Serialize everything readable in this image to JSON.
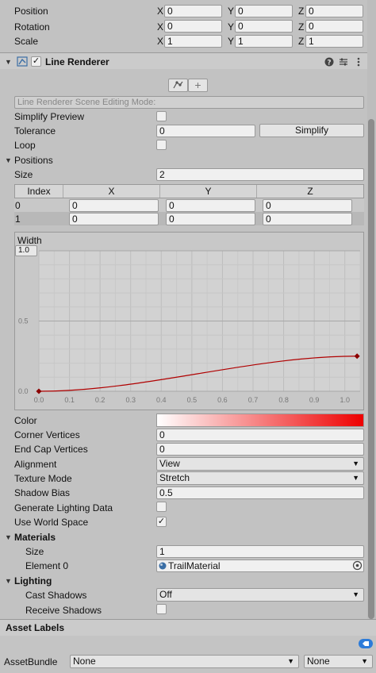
{
  "transform": {
    "position": {
      "label": "Position",
      "x": "0",
      "y": "0",
      "z": "0"
    },
    "rotation": {
      "label": "Rotation",
      "x": "0",
      "y": "0",
      "z": "0"
    },
    "scale": {
      "label": "Scale",
      "x": "1",
      "y": "1",
      "z": "1"
    },
    "axis_x": "X",
    "axis_y": "Y",
    "axis_z": "Z"
  },
  "component": {
    "title": "Line Renderer",
    "enabled": true,
    "scene_mode_label": "Line Renderer Scene Editing Mode:",
    "add_point_glyph": "+"
  },
  "simplify": {
    "preview_label": "Simplify Preview",
    "tolerance_label": "Tolerance",
    "tolerance_value": "0",
    "simplify_button": "Simplify",
    "loop_label": "Loop"
  },
  "positions": {
    "label": "Positions",
    "size_label": "Size",
    "size_value": "2",
    "columns": [
      "Index",
      "X",
      "Y",
      "Z"
    ],
    "rows": [
      {
        "index": "0",
        "x": "0",
        "y": "0",
        "z": "0"
      },
      {
        "index": "1",
        "x": "0",
        "y": "0",
        "z": "0"
      }
    ]
  },
  "width_curve": {
    "title": "Width",
    "max_label": "1.0",
    "chart_data": {
      "type": "line",
      "x_ticks": [
        "0.0",
        "0.1",
        "0.2",
        "0.3",
        "0.4",
        "0.5",
        "0.6",
        "0.7",
        "0.8",
        "0.9",
        "1.0"
      ],
      "y_ticks": [
        "0.0",
        "0.5",
        "1.0"
      ],
      "xlim": [
        0,
        1.05
      ],
      "ylim": [
        0,
        1
      ],
      "keys": [
        {
          "x": 0.0,
          "y": 0.0
        },
        {
          "x": 1.04,
          "y": 0.25
        }
      ],
      "curve_color": "#b00000"
    }
  },
  "props": {
    "color_label": "Color",
    "gradient_start": "#ffffff",
    "gradient_end": "#ee0000",
    "corner_vertices_label": "Corner Vertices",
    "corner_vertices_value": "0",
    "end_cap_label": "End Cap Vertices",
    "end_cap_value": "0",
    "alignment_label": "Alignment",
    "alignment_value": "View",
    "texture_mode_label": "Texture Mode",
    "texture_mode_value": "Stretch",
    "shadow_bias_label": "Shadow Bias",
    "shadow_bias_value": "0.5",
    "gen_lighting_label": "Generate Lighting Data",
    "world_space_label": "Use World Space"
  },
  "materials": {
    "label": "Materials",
    "size_label": "Size",
    "size_value": "1",
    "element_label": "Element 0",
    "element_value": "TrailMaterial"
  },
  "lighting": {
    "label": "Lighting",
    "cast_label": "Cast Shadows",
    "cast_value": "Off",
    "receive_label": "Receive Shadows"
  },
  "asset": {
    "labels_title": "Asset Labels",
    "bundle_label": "AssetBundle",
    "bundle_value": "None",
    "variant_value": "None"
  },
  "icons": {
    "checkmark": "✓",
    "expanded": "▼",
    "dropdown": "▼"
  }
}
